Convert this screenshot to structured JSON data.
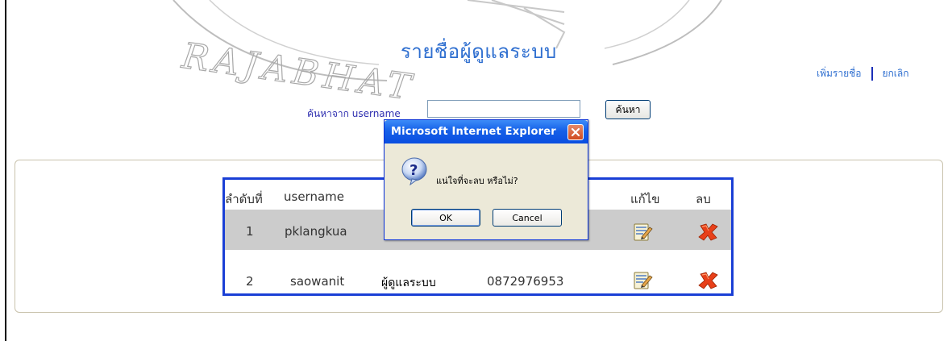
{
  "page": {
    "title": "รายชื่อผู้ดูแลระบบ",
    "watermark_text": "RAJABHAT",
    "add_link": "เพิ่มรายชื่อ",
    "cancel_link": "ยกเลิก"
  },
  "search": {
    "label": "ค้นหาจาก username",
    "value": "",
    "button_label": "ค้นหา"
  },
  "table": {
    "headers": {
      "index": "ลำดับที่",
      "username": "username",
      "edit": "แก้ไข",
      "delete": "ลบ"
    },
    "rows": [
      {
        "index": "1",
        "username": "pklangkua",
        "role": "",
        "phone": ""
      },
      {
        "index": "2",
        "username": "saowanit",
        "role": "ผู้ดูแลระบบ",
        "phone": "0872976953"
      }
    ]
  },
  "dialog": {
    "title": "Microsoft Internet Explorer",
    "message": "แน่ใจที่จะลบ  หรือไม่?",
    "ok_label": "OK",
    "cancel_label": "Cancel"
  },
  "icons": {
    "edit": "edit-document-icon",
    "delete": "delete-x-icon",
    "question": "question-mark-icon",
    "close": "close-icon"
  },
  "colors": {
    "title_blue": "#2f6fd0",
    "table_border": "#1a3fd6",
    "row_highlight": "#cccccc",
    "dialog_titlebar": "#1660e8",
    "delete_red": "#e8401a"
  }
}
